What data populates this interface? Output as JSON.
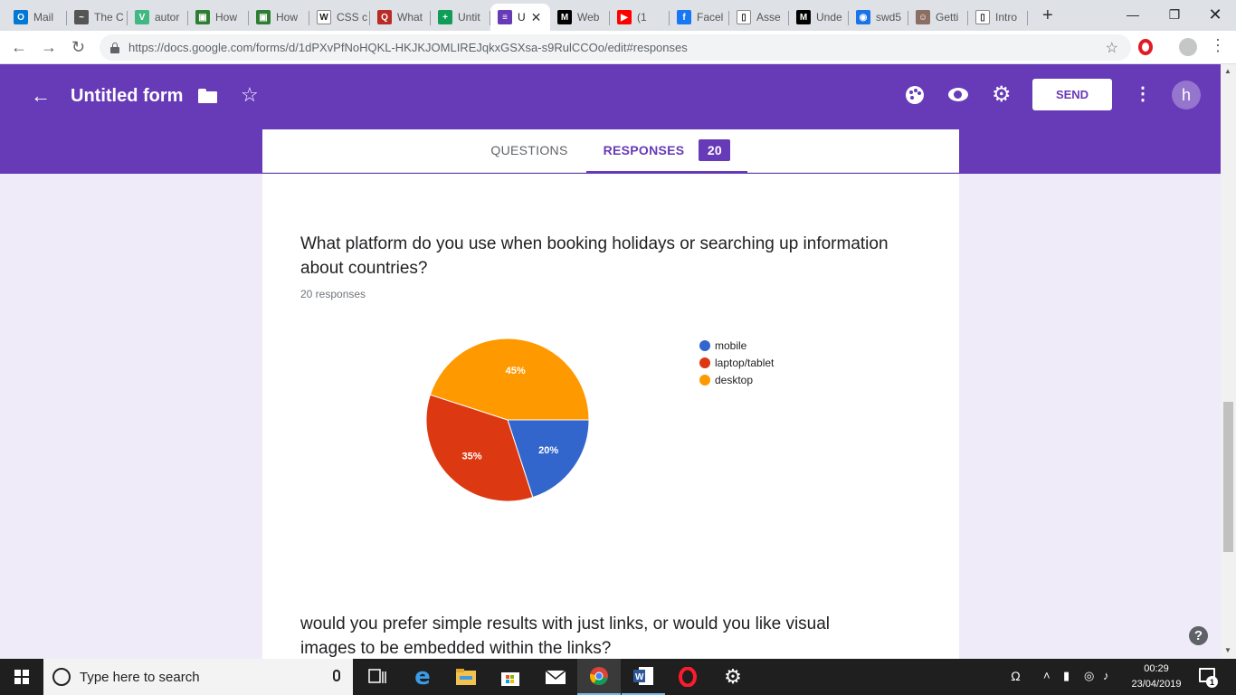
{
  "browser": {
    "tabs": [
      {
        "label": "Mail",
        "icon": "outlook-icon",
        "color": "#0078d4"
      },
      {
        "label": "The C",
        "icon": "chat-icon",
        "color": "#555555"
      },
      {
        "label": "autor",
        "icon": "vue-icon",
        "color": "#41b883"
      },
      {
        "label": "How",
        "icon": "codecademy-icon",
        "color": "#2e7d32"
      },
      {
        "label": "How",
        "icon": "codecademy-icon",
        "color": "#2e7d32"
      },
      {
        "label": "CSS c",
        "icon": "wikipedia-icon",
        "color": "#ffffff"
      },
      {
        "label": "What",
        "icon": "quora-icon",
        "color": "#b92b27"
      },
      {
        "label": "Untit",
        "icon": "sheets-icon",
        "color": "#0f9d58"
      },
      {
        "label": "U",
        "icon": "forms-icon",
        "color": "#673ab7"
      },
      {
        "label": "Web",
        "icon": "medium-icon",
        "color": "#000000"
      },
      {
        "label": "(1",
        "icon": "youtube-icon",
        "color": "#ff0000"
      },
      {
        "label": "Facel",
        "icon": "facebook-icon",
        "color": "#1877f2"
      },
      {
        "label": "Asse",
        "icon": "page-icon",
        "color": "#ffffff"
      },
      {
        "label": "Unde",
        "icon": "medium-icon",
        "color": "#000000"
      },
      {
        "label": "swd5",
        "icon": "app-icon",
        "color": "#1a73e8"
      },
      {
        "label": "Getti",
        "icon": "person-icon",
        "color": "#8d6e63"
      },
      {
        "label": "Intro",
        "icon": "page-icon",
        "color": "#ffffff"
      }
    ],
    "active_tab_index": 8,
    "url": "https://docs.google.com/forms/d/1dPXvPfNoHQKL-HKJKJOMLIREJqkxGSXsa-s9RulCCOo/edit#responses"
  },
  "forms_header": {
    "title": "Untitled form",
    "send_label": "SEND",
    "avatar_letter": "h",
    "accent_color": "#673ab7"
  },
  "tabs": {
    "questions_label": "QUESTIONS",
    "responses_label": "RESPONSES",
    "responses_count": "20"
  },
  "question1": {
    "title": "What platform do you use when booking holidays or searching up information about countries?",
    "response_count": "20 responses"
  },
  "chart_data": {
    "type": "pie",
    "categories": [
      "mobile",
      "laptop/tablet",
      "desktop"
    ],
    "values": [
      20,
      35,
      45
    ],
    "labels": [
      "20%",
      "35%",
      "45%"
    ],
    "colors": [
      "#3366cc",
      "#dc3912",
      "#ff9900"
    ],
    "legend_position": "right"
  },
  "question2": {
    "title": "would you prefer simple results with just links, or would you like visual images to be embedded within the links?"
  },
  "taskbar": {
    "search_placeholder": "Type here to search",
    "time": "00:29",
    "date": "23/04/2019",
    "notification_count": "1"
  }
}
